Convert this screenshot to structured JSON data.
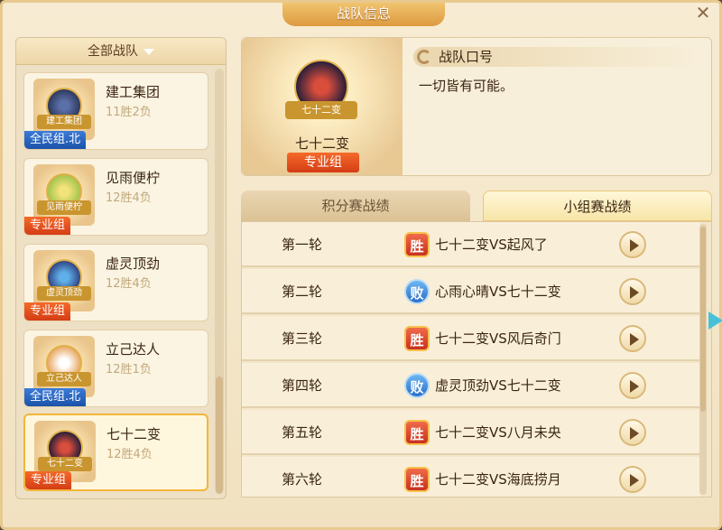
{
  "window": {
    "title": "战队信息",
    "close": "✕"
  },
  "left": {
    "header": "全部战队",
    "teams": [
      {
        "name": "建工集团",
        "record": "11胜2负",
        "group": "全民组.北",
        "group_type": "pop",
        "logo_text": "建工集团"
      },
      {
        "name": "见雨便柠",
        "record": "12胜4负",
        "group": "专业组",
        "group_type": "pro",
        "logo_text": "见雨便柠"
      },
      {
        "name": "虚灵顶劲",
        "record": "12胜4负",
        "group": "专业组",
        "group_type": "pro",
        "logo_text": "虚灵顶劲"
      },
      {
        "name": "立己达人",
        "record": "12胜1负",
        "group": "全民组.北",
        "group_type": "pop",
        "logo_text": "立己达人"
      },
      {
        "name": "七十二变",
        "record": "12胜4负",
        "group": "专业组",
        "group_type": "pro",
        "logo_text": "七十二变",
        "selected": true
      }
    ]
  },
  "detail": {
    "team_name": "七十二变",
    "logo_text": "七十二变",
    "group": "专业组",
    "motto_title": "战队口号",
    "motto": "一切皆有可能。"
  },
  "tabs": {
    "points": "积分赛战绩",
    "group": "小组赛战绩"
  },
  "rounds": [
    {
      "label": "第一轮",
      "result": "胜",
      "type": "win",
      "match": "七十二变VS起风了"
    },
    {
      "label": "第二轮",
      "result": "败",
      "type": "lose",
      "match": "心雨心晴VS七十二变"
    },
    {
      "label": "第三轮",
      "result": "胜",
      "type": "win",
      "match": "七十二变VS风后奇门"
    },
    {
      "label": "第四轮",
      "result": "败",
      "type": "lose",
      "match": "虚灵顶劲VS七十二变"
    },
    {
      "label": "第五轮",
      "result": "胜",
      "type": "win",
      "match": "七十二变VS八月未央"
    },
    {
      "label": "第六轮",
      "result": "胜",
      "type": "win",
      "match": "七十二变VS海底捞月"
    }
  ]
}
